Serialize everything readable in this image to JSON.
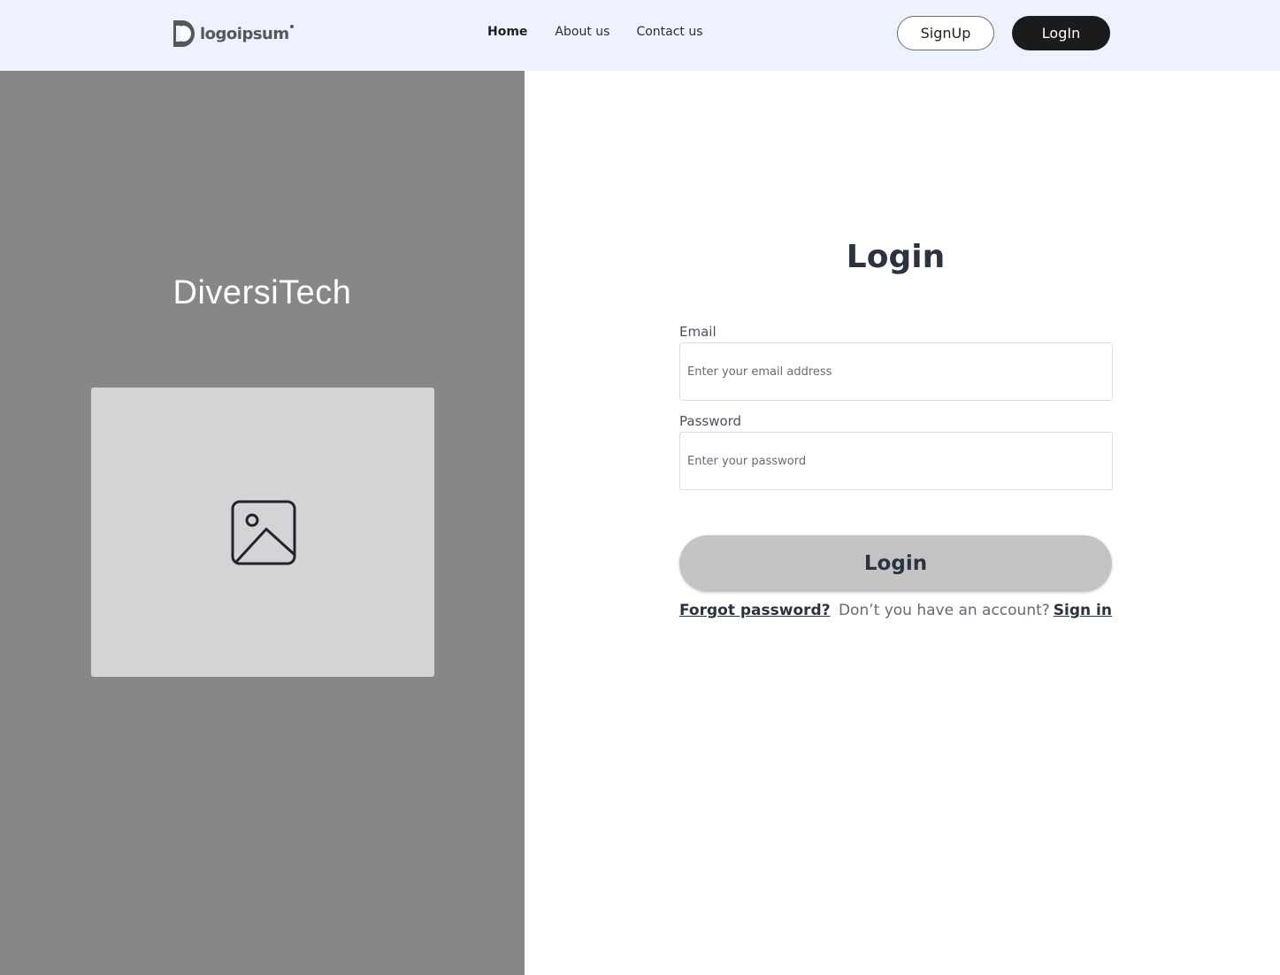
{
  "header": {
    "logo_text": "logoipsum",
    "nav": {
      "home": "Home",
      "about": "About us",
      "contact": "Contact us"
    },
    "signup_label": "SignUp",
    "login_label": "LogIn"
  },
  "left_panel": {
    "brand": "DiversiTech",
    "image_icon": "image-icon"
  },
  "form": {
    "title": "Login",
    "email_label": "Email",
    "email_placeholder": "Enter your email address",
    "email_value": "",
    "password_label": "Password",
    "password_placeholder": "Enter your password",
    "password_value": "",
    "submit_label": "Login",
    "forgot_label": "Forgot password?",
    "no_account_text": "Don’t you have an account?",
    "signin_label": "Sign in"
  },
  "colors": {
    "header_bg": "#edf2fe",
    "left_panel_bg": "#878787",
    "placeholder_bg": "#d3d4d6",
    "primary_dark": "#1a1b1d",
    "submit_bg": "#c4c4c4",
    "heading_text": "#2b3340"
  }
}
